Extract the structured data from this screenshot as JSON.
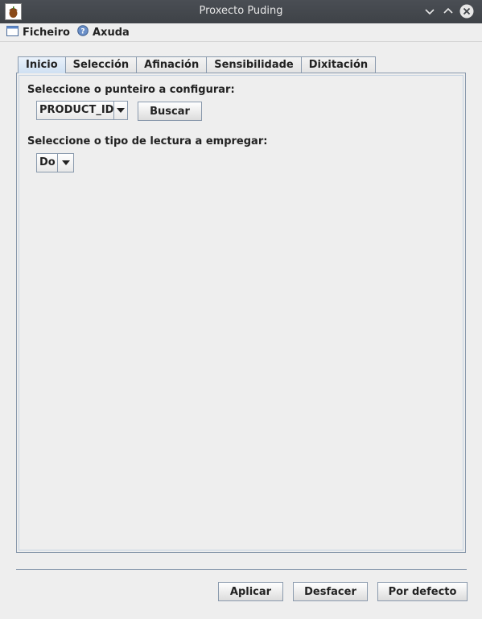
{
  "window": {
    "title": "Proxecto Puding"
  },
  "menubar": {
    "items": [
      {
        "label": "Ficheiro",
        "icon": "window-icon"
      },
      {
        "label": "Axuda",
        "icon": "help-icon"
      }
    ]
  },
  "tabs": [
    {
      "label": "Inicio",
      "active": true
    },
    {
      "label": "Selección"
    },
    {
      "label": "Afinación"
    },
    {
      "label": "Sensibilidade"
    },
    {
      "label": "Dixitación"
    }
  ],
  "inicio": {
    "pointer_label": "Seleccione o punteiro a configurar:",
    "pointer_value": "PRODUCT_ID",
    "search_button": "Buscar",
    "reading_label": "Seleccione o tipo de lectura a empregar:",
    "reading_value": "Do"
  },
  "footer": {
    "apply": "Aplicar",
    "undo": "Desfacer",
    "default": "Por defecto"
  },
  "colors": {
    "titlebar": "#3e4247",
    "accent": "#8a9aad",
    "background": "#eeeeee"
  }
}
